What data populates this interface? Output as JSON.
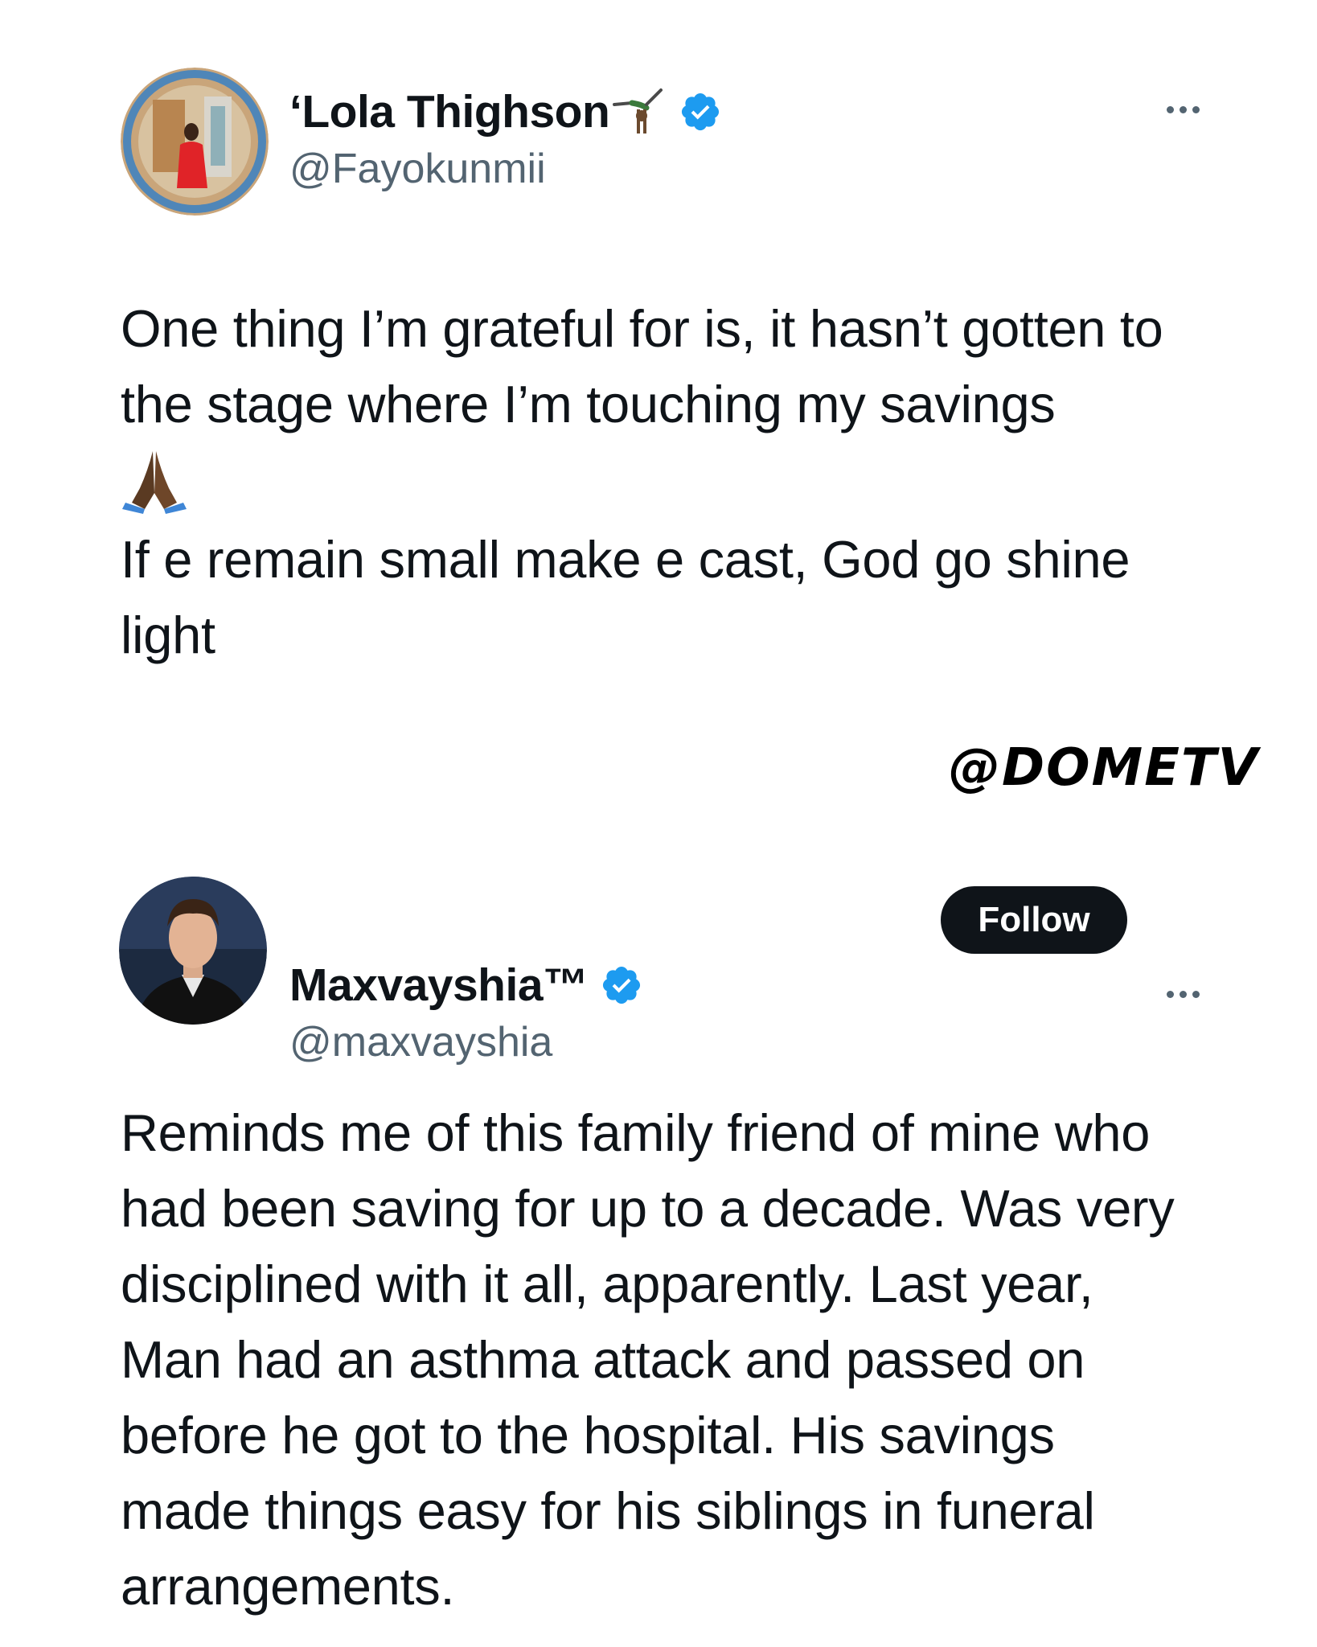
{
  "tweets": [
    {
      "display_name": "‘Lola Thighson",
      "name_emoji_icon": "cartwheel-person-icon",
      "verified_icon": "verified-badge-icon",
      "handle": "@Fayokunmii",
      "more_icon": "more-options-icon",
      "text_line_1": "One thing I’m grateful for is, it hasn’t gotten to the stage where I’m touching my savings",
      "emoji_icon": "folded-hands-icon",
      "text_line_2": "If e remain small make e cast, God go shine light"
    },
    {
      "display_name": "Maxvayshia™",
      "verified_icon": "verified-badge-icon",
      "handle": "@maxvayshia",
      "follow_label": "Follow",
      "more_icon": "more-options-icon",
      "text": "Reminds me of this family friend of mine who had been saving for up to a decade. Was very disciplined with it all, apparently. Last year, Man had an asthma attack and passed on before he got to the hospital. His savings made things easy for his siblings in funeral arrangements."
    }
  ],
  "watermark": "@DOMETV",
  "colors": {
    "text": "#0f1419",
    "secondary": "#536471",
    "verified": "#1d9bf0",
    "button": "#0f1419"
  }
}
